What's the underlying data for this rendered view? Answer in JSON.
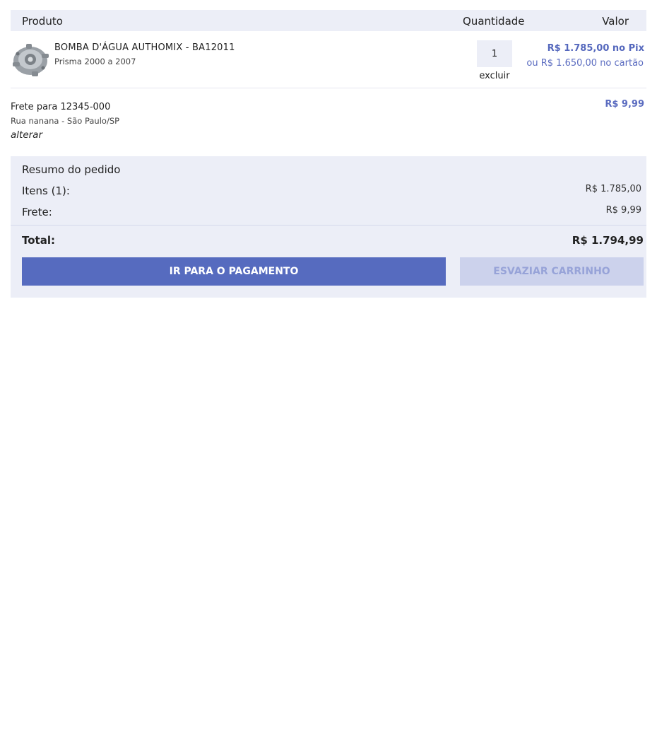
{
  "header": {
    "product": "Produto",
    "quantity": "Quantidade",
    "value": "Valor"
  },
  "item": {
    "name": "BOMBA D'ÁGUA AUTHOMIX - BA12011",
    "subtitle": "Prisma 2000 a 2007",
    "image_icon": "water-pump-image",
    "quantity": "1",
    "remove_label": "excluir",
    "price_pix": "R$ 1.785,00 no Pix",
    "price_card": "ou R$ 1.650,00 no cartão"
  },
  "shipping": {
    "title": "Frete para 12345-000",
    "address": "Rua nanana - São Paulo/SP",
    "change_label": "alterar",
    "price": "R$ 9,99"
  },
  "summary": {
    "title": "Resumo do pedido",
    "items_label": "Itens (1):",
    "items_value": "R$ 1.785,00",
    "freight_label": "Frete:",
    "freight_value": "R$ 9,99",
    "total_label": "Total:",
    "total_value": "R$ 1.794,99",
    "pay_button": "IR PARA O PAGAMENTO",
    "empty_button": "ESVAZIAR CARRINHO"
  },
  "colors": {
    "accent": "#566bbf",
    "panel": "#eceef7",
    "disabled_button": "#ccd2ec"
  }
}
